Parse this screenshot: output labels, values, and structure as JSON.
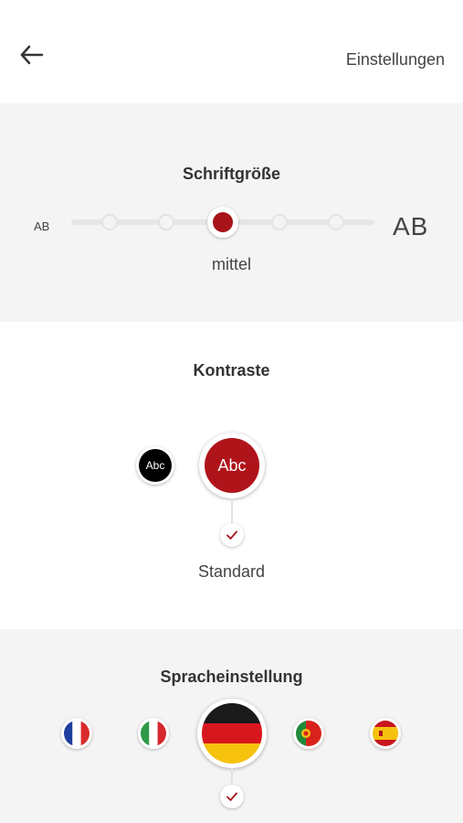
{
  "header": {
    "title": "Einstellungen",
    "back_icon": "arrow-left-icon"
  },
  "font_size": {
    "title": "Schriftgröße",
    "small_label": "AB",
    "large_label": "AB",
    "steps": 6,
    "selected_index": 2,
    "selected_label": "mittel",
    "accent": "#a8131a"
  },
  "contrast": {
    "title": "Kontraste",
    "options": [
      {
        "name": "dark",
        "label": "Abc",
        "color": "#000000"
      },
      {
        "name": "red",
        "label": "Abc",
        "color": "#b0141b",
        "selected": true
      }
    ],
    "selected_label": "Standard"
  },
  "language": {
    "title": "Spracheinstellung",
    "flags": [
      "france-flag-icon",
      "italy-flag-icon",
      "germany-flag-icon",
      "portugal-flag-icon",
      "spain-flag-icon"
    ],
    "selected": "germany-flag-icon"
  }
}
